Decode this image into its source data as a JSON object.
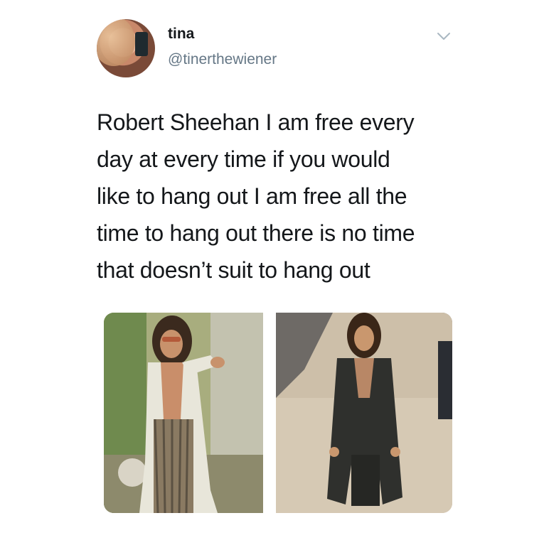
{
  "tweet": {
    "display_name": "tina",
    "handle": "@tinerthewiener",
    "text": "Robert Sheehan I am free every\nday at every time if you would\nlike to hang out I am free all the\ntime to hang out there is no time\nthat doesn’t suit to hang out",
    "media_count": 2,
    "icons": [
      "avatar",
      "chevron-down-icon"
    ]
  },
  "colors": {
    "text": "#14171a",
    "secondary": "#657786",
    "caret": "#aab8c2"
  }
}
